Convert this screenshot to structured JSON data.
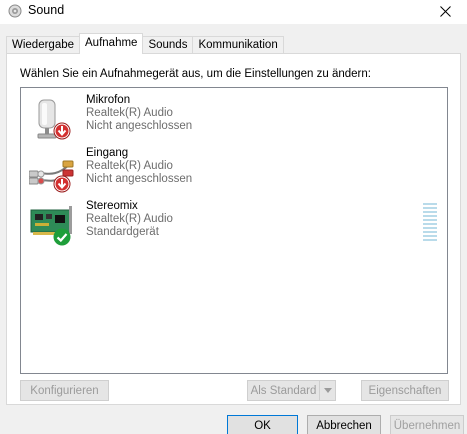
{
  "window": {
    "title": "Sound",
    "close_icon": "close-icon"
  },
  "tabs": [
    {
      "label": "Wiedergabe",
      "active": false
    },
    {
      "label": "Aufnahme",
      "active": true
    },
    {
      "label": "Sounds",
      "active": false
    },
    {
      "label": "Kommunikation",
      "active": false
    }
  ],
  "panel": {
    "instruction": "Wählen Sie ein Aufnahmegerät aus, um die Einstellungen zu ändern:"
  },
  "devices": [
    {
      "name": "Mikrofon",
      "driver": "Realtek(R) Audio",
      "status": "Nicht angeschlossen",
      "icon": "microphone-icon",
      "badge": "disconnected-badge-icon"
    },
    {
      "name": "Eingang",
      "driver": "Realtek(R) Audio",
      "status": "Nicht angeschlossen",
      "icon": "line-in-cable-icon",
      "badge": "disconnected-badge-icon"
    },
    {
      "name": "Stereomix",
      "driver": "Realtek(R) Audio",
      "status": "Standardgerät",
      "icon": "sound-card-icon",
      "badge": "default-device-check-icon"
    }
  ],
  "panel_buttons": {
    "configure": "Konfigurieren",
    "set_default": "Als Standard",
    "properties": "Eigenschaften"
  },
  "dialog_buttons": {
    "ok": "OK",
    "cancel": "Abbrechen",
    "apply": "Übernehmen"
  },
  "colors": {
    "accent": "#0078d7",
    "badge_red": "#d32f2f",
    "badge_green": "#1e9e3a",
    "level_meter": "#b9dbea"
  }
}
